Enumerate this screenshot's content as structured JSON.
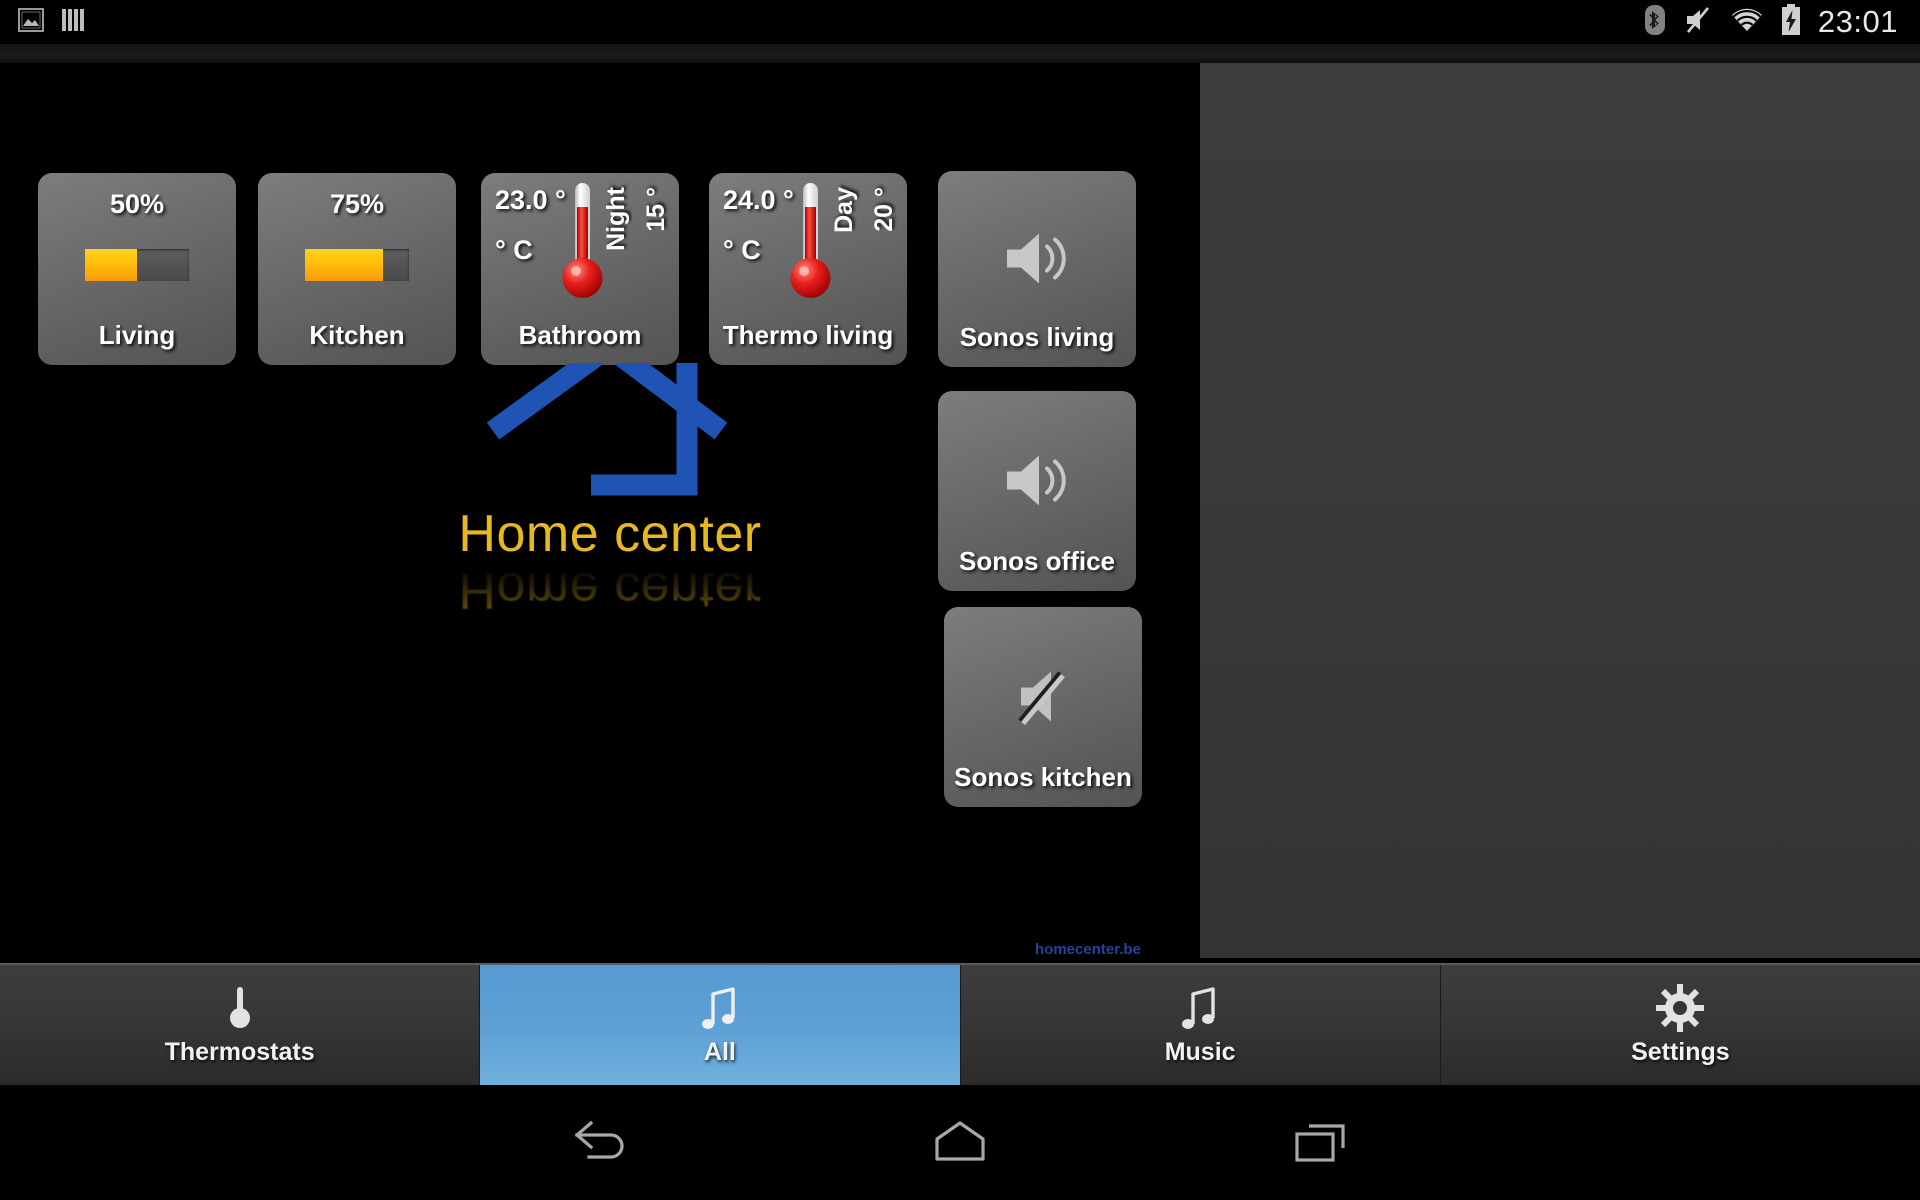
{
  "statusbar": {
    "left_icons": [
      {
        "name": "screenshot-image-icon"
      },
      {
        "name": "sd-storage-bars-icon"
      }
    ],
    "right_icons": [
      {
        "name": "bluetooth-icon"
      },
      {
        "name": "volume-muted-icon"
      },
      {
        "name": "wifi-icon"
      },
      {
        "name": "battery-charging-icon"
      }
    ],
    "clock": "23:01"
  },
  "app": {
    "logo": {
      "title": "Home center",
      "reflection": "Home center",
      "icon_name": "house-outline-logo",
      "color": "#e8b820",
      "house_color": "#1f54b5"
    },
    "site_link": "homecenter.be"
  },
  "dimmers": [
    {
      "name": "Living",
      "percent_label": "50%",
      "percent": 50
    },
    {
      "name": "Kitchen",
      "percent_label": "75%",
      "percent": 75
    }
  ],
  "thermostats": [
    {
      "name": "Bathroom",
      "temperature": "23.0 °",
      "unit": "° C",
      "mode": "Night",
      "setpoint": "15 °"
    },
    {
      "name": "Thermo living",
      "temperature": "24.0 °",
      "unit": "° C",
      "mode": "Day",
      "setpoint": "20 °"
    }
  ],
  "speakers": [
    {
      "name": "Sonos living",
      "state": "on",
      "icon": "speaker-on-icon"
    },
    {
      "name": "Sonos office",
      "state": "on",
      "icon": "speaker-on-icon"
    },
    {
      "name": "Sonos kitchen",
      "state": "muted",
      "icon": "speaker-muted-icon"
    }
  ],
  "tabs": [
    {
      "label": "Thermostats",
      "icon": "thermometer-icon",
      "active": false
    },
    {
      "label": "All",
      "icon": "music-note-icon",
      "active": true
    },
    {
      "label": "Music",
      "icon": "music-note-icon",
      "active": false
    },
    {
      "label": "Settings",
      "icon": "gear-icon",
      "active": false
    }
  ],
  "navbar": [
    {
      "name": "back-icon"
    },
    {
      "name": "home-icon"
    },
    {
      "name": "recents-icon"
    }
  ],
  "colors": {
    "accent_blue": "#5ea0d4",
    "logo_gold": "#e8b820",
    "house_blue": "#1f54b5",
    "dimmer_fill": "#ffc20a",
    "link_blue": "#2b3fa0"
  }
}
